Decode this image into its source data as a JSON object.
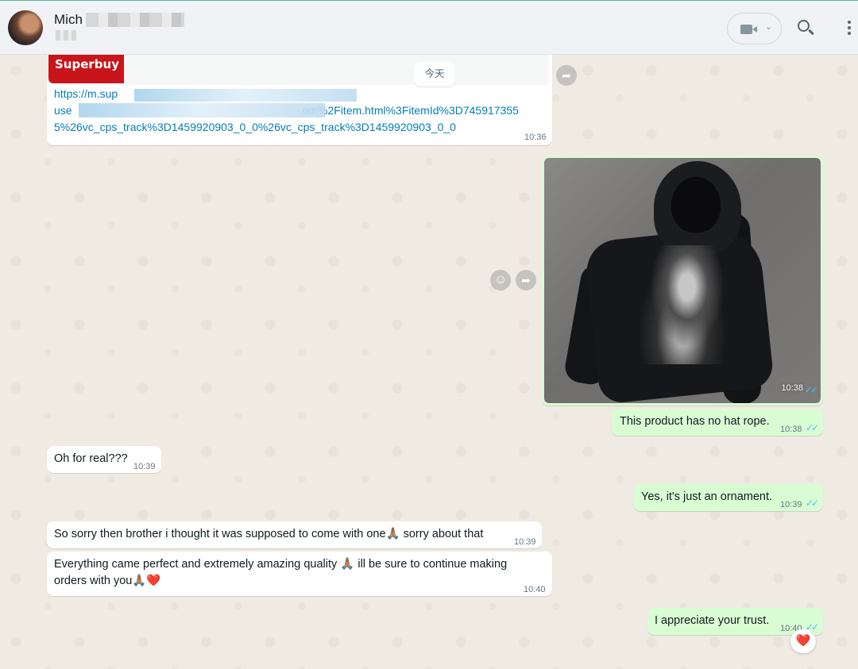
{
  "header": {
    "contact_name": "Mich",
    "video_icon": "video-camera-icon",
    "video_chevron": "⌄",
    "search_icon": "search-icon",
    "menu_icon": "vertical-dots-icon"
  },
  "chat": {
    "date_chip": "今天",
    "link_message": {
      "brand": "Superbuy",
      "line1": "https://m.sup",
      "line2_start": "use",
      "line2_end": "om%2Fitem.html%3FitemId%3D745917355",
      "line3": "5%26vc_cps_track%3D1459920903_0_0%26vc_cps_track%3D1459920903_0_0",
      "time": "10:36"
    },
    "image_message": {
      "time": "10:38",
      "status": "read"
    },
    "messages": [
      {
        "id": "m1",
        "direction": "out",
        "text": "This product has no hat rope.",
        "time": "10:38",
        "status": "read"
      },
      {
        "id": "m2",
        "direction": "in",
        "text": "Oh for real???",
        "time": "10:39"
      },
      {
        "id": "m3",
        "direction": "out",
        "text": "Yes, it's just an ornament.",
        "time": "10:39",
        "status": "read"
      },
      {
        "id": "m4",
        "direction": "in",
        "text_a": "So sorry then brother i thought it was supposed to come with one",
        "emoji": "🙏🏽",
        "text_b": " sorry about that",
        "time": "10:39"
      },
      {
        "id": "m5",
        "direction": "in",
        "line1_a": "Everything came perfect and extremely amazing quality ",
        "line1_emoji": "🙏🏽",
        "line1_b": " ill be sure to continue making",
        "line2_a": "orders with you",
        "line2_emoji": "🙏🏽❤️",
        "time": "10:40"
      },
      {
        "id": "m6",
        "direction": "out",
        "text": "I appreciate your trust.",
        "time": "10:40",
        "status": "read",
        "reaction": "❤️"
      }
    ],
    "ticks_glyph": "✓✓",
    "forward_glyph": "➦",
    "react_glyph": "☺"
  },
  "colors": {
    "chat_background": "#efeae2",
    "incoming_bubble": "#ffffff",
    "outgoing_bubble": "#d9fdd3",
    "read_ticks": "#53bdeb",
    "link": "#027eb5"
  }
}
